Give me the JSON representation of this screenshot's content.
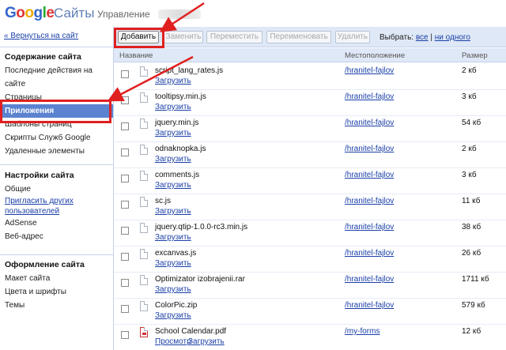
{
  "header": {
    "logo_letters": [
      "G",
      "o",
      "o",
      "g",
      "l",
      "e"
    ],
    "logo_colors": [
      "#3366cc",
      "#dd3333",
      "#eeaa00",
      "#3366cc",
      "#22aa33",
      "#dd3333"
    ],
    "product": "Сайты",
    "manage": "Управление"
  },
  "sidebar": {
    "back": "« Вернуться на сайт",
    "content": {
      "title": "Содержание сайта",
      "items": [
        "Последние действия на",
        "сайте",
        "Страницы",
        "Приложения",
        "Шаблоны страниц",
        "Скрипты Служб Google",
        "Удаленные элементы"
      ],
      "active_index": 3
    },
    "settings": {
      "title": "Настройки сайта",
      "items": [
        "Общие",
        "Пригласить других",
        "пользователей",
        "AdSense",
        "Веб-адрес"
      ]
    },
    "design": {
      "title": "Оформление сайта",
      "items": [
        "Макет сайта",
        "Цвета и шрифты",
        "Темы"
      ]
    }
  },
  "toolbar": {
    "buttons": [
      "Добавить",
      "Заменить",
      "Переместить",
      "Переименовать",
      "Удалить"
    ],
    "select_label": "Выбрать:",
    "select_all": "все",
    "select_none": "ни одного",
    "select_sep": "|"
  },
  "table": {
    "columns": [
      "Название",
      "Местоположение",
      "Размер"
    ],
    "rows": [
      {
        "name": "script_lang_rates.js",
        "action": "Загрузить",
        "location": "/hranitel-fajlov",
        "size": "2 кб"
      },
      {
        "name": "tooltipsy.min.js",
        "action": "Загрузить",
        "location": "/hranitel-fajlov",
        "size": "3 кб"
      },
      {
        "name": "jquery.min.js",
        "action": "Загрузить",
        "location": "/hranitel-fajlov",
        "size": "54 кб"
      },
      {
        "name": "odnaknopka.js",
        "action": "Загрузить",
        "location": "/hranitel-fajlov",
        "size": "2 кб"
      },
      {
        "name": "comments.js",
        "action": "Загрузить",
        "location": "/hranitel-fajlov",
        "size": "3 кб"
      },
      {
        "name": "sc.js",
        "action": "Загрузить",
        "location": "/hranitel-fajlov",
        "size": "11 кб"
      },
      {
        "name": "jquery.qtip-1.0.0-rc3.min.js",
        "action": "Загрузить",
        "location": "/hranitel-fajlov",
        "size": "38 кб"
      },
      {
        "name": "excanvas.js",
        "action": "Загрузить",
        "location": "/hranitel-fajlov",
        "size": "26 кб"
      },
      {
        "name": "Optimizator izobrajenii.rar",
        "action": "Загрузить",
        "location": "/hranitel-fajlov",
        "size": "1711 кб"
      },
      {
        "name": "ColorPic.zip",
        "action": "Загрузить",
        "location": "/hranitel-fajlov",
        "size": "579 кб"
      },
      {
        "name": "School Calendar.pdf",
        "action": "Просмотр",
        "action2": "Загрузить",
        "location": "/my-forms",
        "size": "12 кб"
      }
    ]
  },
  "colors": {
    "accent": "#5b83d0",
    "toolbar_bg": "#dfe8f6",
    "annotation": "#e02020",
    "link": "#1a3fa8"
  }
}
